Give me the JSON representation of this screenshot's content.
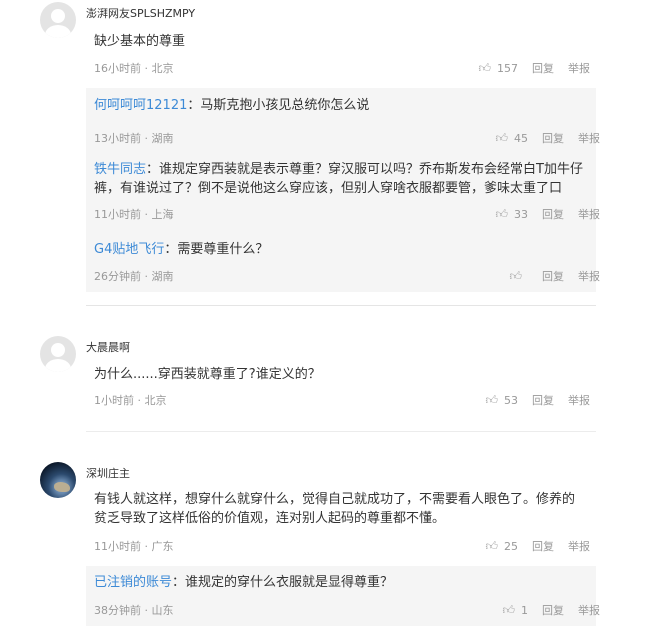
{
  "comments": [
    {
      "username": "澎湃网友SPLSHZMPY",
      "content": "缺少基本的尊重",
      "time": "16小时前 · 北京",
      "likes": "157",
      "reply_label": "回复",
      "report_label": "举报",
      "replies": [
        {
          "user": "何呵呵呵12121",
          "sep": "：",
          "text": "马斯克抱小孩见总统你怎么说",
          "time": "13小时前 · 湖南",
          "likes": "45",
          "reply_label": "回复",
          "report_label": "举报"
        },
        {
          "user": "铁牛同志",
          "sep": "：",
          "text": "谁规定穿西装就是表示尊重？穿汉服可以吗？乔布斯发布会经常白T加牛仔裤，有谁说过了？倒不是说他这么穿应该，但别人穿啥衣服都要管，爹味太重了口",
          "time": "11小时前 · 上海",
          "likes": "33",
          "reply_label": "回复",
          "report_label": "举报"
        },
        {
          "user": "G4贴地飞行",
          "sep": "：",
          "text": "需要尊重什么？",
          "time": "26分钟前 · 湖南",
          "likes": "",
          "reply_label": "回复",
          "report_label": "举报"
        }
      ]
    },
    {
      "username": "大晨晨啊",
      "content": "为什么......穿西装就尊重了?谁定义的？",
      "time": "1小时前 · 北京",
      "likes": "53",
      "reply_label": "回复",
      "report_label": "举报"
    },
    {
      "username": "深圳庄主",
      "content": "有钱人就这样，想穿什么就穿什么，觉得自己就成功了，不需要看人眼色了。修养的贫乏导致了这样低俗的价值观，连对别人起码的尊重都不懂。",
      "time": "11小时前 · 广东",
      "likes": "25",
      "reply_label": "回复",
      "report_label": "举报",
      "replies": [
        {
          "user": "已注销的账号",
          "sep": "：",
          "text": "谁规定的穿什么衣服就是显得尊重？",
          "time": "38分钟前 · 山东",
          "likes": "1",
          "reply_label": "回复",
          "report_label": "举报"
        }
      ]
    }
  ]
}
